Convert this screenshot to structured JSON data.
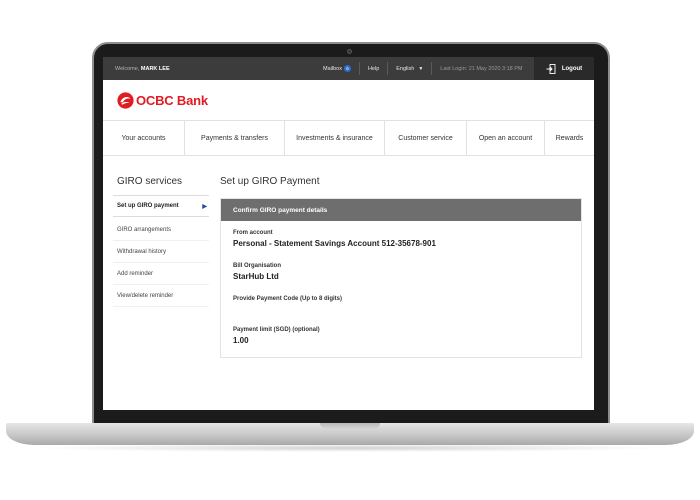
{
  "topbar": {
    "welcome_prefix": "Welcome,",
    "user_name": "MARK LEE",
    "mailbox_label": "Mailbox",
    "mailbox_count": "6",
    "help_label": "Help",
    "language": "English",
    "last_login": "Last Login: 21 May 2020 3:18 PM",
    "logout_label": "Logout"
  },
  "brand": {
    "name": "OCBC Bank",
    "color": "#e11b22"
  },
  "nav": [
    "Your accounts",
    "Payments & transfers",
    "Investments & insurance",
    "Customer service",
    "Open an account",
    "Rewards"
  ],
  "sidebar": {
    "title": "GIRO services",
    "items": [
      "Set up GIRO payment",
      "GIRO arrangements",
      "Withdrawal history",
      "Add reminder",
      "View/delete reminder"
    ]
  },
  "main": {
    "title": "Set up GIRO Payment",
    "panel_title": "Confirm GIRO payment details",
    "fields": [
      {
        "label": "From account",
        "value": "Personal - Statement Savings Account 512-35678-901"
      },
      {
        "label": "Bill Organisation",
        "value": "StarHub Ltd"
      },
      {
        "label": "Provide Payment Code (Up to 8 digits)",
        "value": ""
      },
      {
        "label": "Payment limit (SGD) (optional)",
        "value": "1.00"
      }
    ]
  }
}
